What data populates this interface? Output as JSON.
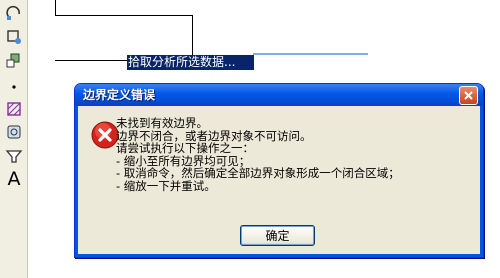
{
  "canvas": {
    "command_hint": "拾取分析所选数据..."
  },
  "toolbar": {
    "tools": [
      "arc-tool-icon",
      "polygon-tool-icon",
      "insert-block-icon",
      "point-icon",
      "hatch-icon",
      "region-icon",
      "table-icon",
      "text-tool-icon"
    ],
    "text_tool_glyph": "A"
  },
  "dialog": {
    "title": "边界定义错误",
    "icon": "error-icon",
    "message_lines": [
      "未找到有效边界。",
      "边界不闭合，或者边界对象不可访问。",
      "请尝试执行以下操作之一：",
      "- 缩小至所有边界均可见；",
      "- 取消命令，然后确定全部边界对象形成一个闭合区域；",
      "- 缩放一下并重试。"
    ],
    "ok_label": "确定",
    "colors": {
      "titlebar": "#0058e6",
      "body": "#ece9d8",
      "error_red": "#d4231c"
    }
  }
}
